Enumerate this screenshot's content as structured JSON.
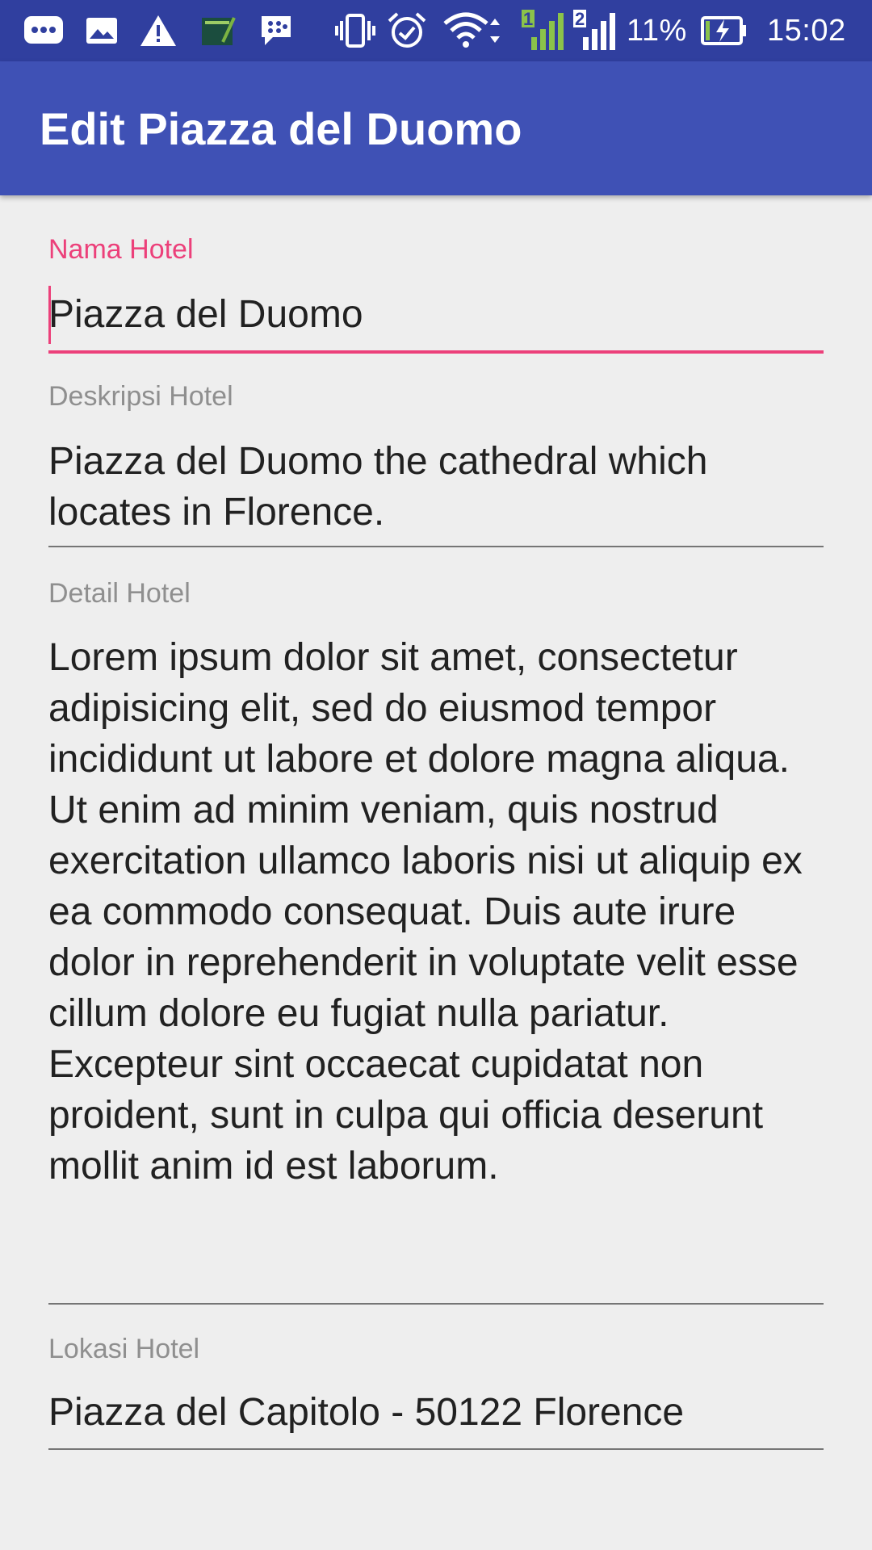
{
  "status_bar": {
    "icons": [
      "message-icon",
      "image-icon",
      "warning-icon",
      "notebook-icon",
      "bbm-icon",
      "vibrate-icon",
      "alarm-icon",
      "wifi-icon",
      "signal-sim1-icon",
      "signal-sim2-icon",
      "battery-charging-icon"
    ],
    "sim1_label": "1",
    "sim2_label": "2",
    "battery_percent": "11%",
    "time": "15:02",
    "color": "#303f9f"
  },
  "toolbar": {
    "title": "Edit Piazza del Duomo",
    "color": "#3f51b5"
  },
  "accent_color": "#ec407a",
  "form": {
    "name": {
      "label": "Nama Hotel",
      "value": "Piazza del Duomo"
    },
    "description": {
      "label": "Deskripsi Hotel",
      "value": "Piazza del Duomo the cathedral which locates in Florence."
    },
    "detail": {
      "label": "Detail Hotel",
      "value": "Lorem ipsum dolor sit amet, consectetur adipisicing elit, sed do eiusmod tempor incididunt ut labore et dolore magna aliqua. Ut enim ad minim veniam, quis nostrud exercitation ullamco laboris nisi ut aliquip ex ea commodo consequat. Duis aute irure dolor in reprehenderit in voluptate velit esse cillum dolore eu fugiat nulla pariatur. Excepteur sint occaecat cupidatat non proident, sunt in culpa qui officia deserunt mollit anim id est laborum."
    },
    "location": {
      "label": "Lokasi Hotel",
      "value": "Piazza del Capitolo - 50122 Florence"
    }
  }
}
